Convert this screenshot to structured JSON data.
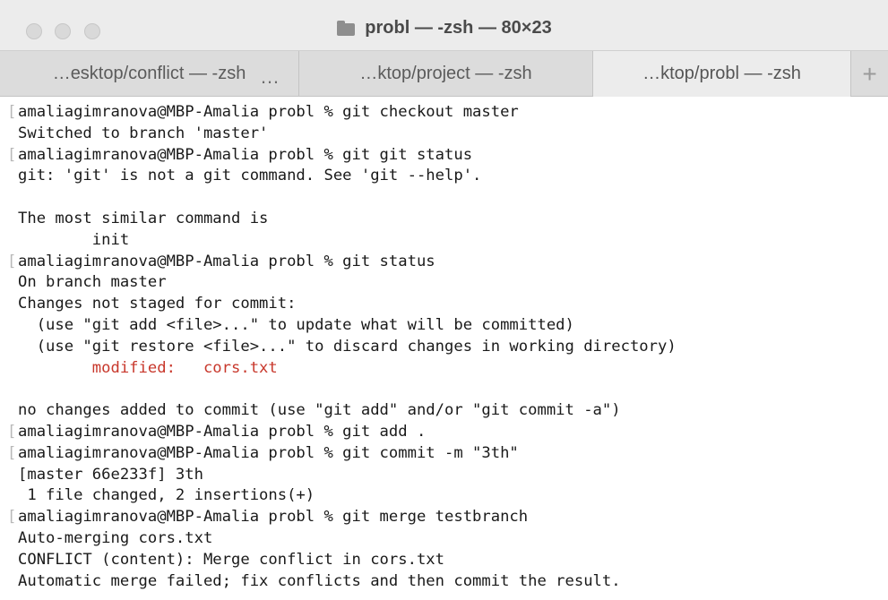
{
  "window": {
    "title": "probl — -zsh — 80×23",
    "title_icon": "folder-icon"
  },
  "tabs": [
    {
      "label": "…esktop/conflict — -zsh",
      "active": false
    },
    {
      "label": "…ktop/project — -zsh",
      "active": false
    },
    {
      "label": "…ktop/probl — -zsh",
      "active": true
    }
  ],
  "tab_overflow": "…",
  "tab_add": "+",
  "colors": {
    "error_text": "#c8382c",
    "text": "#1a1a1a"
  },
  "lines": [
    {
      "text": "amaliagimranova@MBP-Amalia probl % git checkout master",
      "kind": "prompt"
    },
    {
      "text": "Switched to branch 'master'",
      "kind": "output"
    },
    {
      "text": "amaliagimranova@MBP-Amalia probl % git git status",
      "kind": "prompt"
    },
    {
      "text": "git: 'git' is not a git command. See 'git --help'.",
      "kind": "output"
    },
    {
      "text": "",
      "kind": "output"
    },
    {
      "text": "The most similar command is",
      "kind": "output"
    },
    {
      "text": "        init",
      "kind": "output"
    },
    {
      "text": "amaliagimranova@MBP-Amalia probl % git status",
      "kind": "prompt"
    },
    {
      "text": "On branch master",
      "kind": "output"
    },
    {
      "text": "Changes not staged for commit:",
      "kind": "output"
    },
    {
      "text": "  (use \"git add <file>...\" to update what will be committed)",
      "kind": "output"
    },
    {
      "text": "  (use \"git restore <file>...\" to discard changes in working directory)",
      "kind": "output"
    },
    {
      "text": "        modified:   cors.txt",
      "kind": "error"
    },
    {
      "text": "",
      "kind": "output"
    },
    {
      "text": "no changes added to commit (use \"git add\" and/or \"git commit -a\")",
      "kind": "output"
    },
    {
      "text": "amaliagimranova@MBP-Amalia probl % git add .",
      "kind": "prompt"
    },
    {
      "text": "amaliagimranova@MBP-Amalia probl % git commit -m \"3th\"",
      "kind": "prompt"
    },
    {
      "text": "[master 66e233f] 3th",
      "kind": "output"
    },
    {
      "text": " 1 file changed, 2 insertions(+)",
      "kind": "output"
    },
    {
      "text": "amaliagimranova@MBP-Amalia probl % git merge testbranch",
      "kind": "prompt"
    },
    {
      "text": "Auto-merging cors.txt",
      "kind": "output"
    },
    {
      "text": "CONFLICT (content): Merge conflict in cors.txt",
      "kind": "output"
    },
    {
      "text": "Automatic merge failed; fix conflicts and then commit the result.",
      "kind": "output"
    }
  ]
}
